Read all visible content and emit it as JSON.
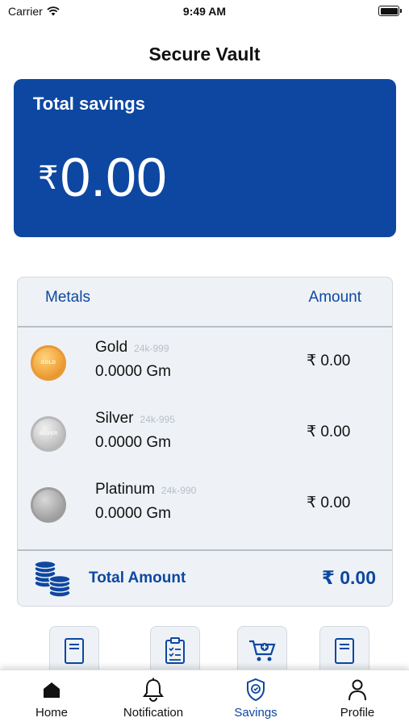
{
  "status_bar": {
    "carrier": "Carrier",
    "time": "9:49 AM"
  },
  "header": {
    "title": "Secure Vault"
  },
  "savings": {
    "label": "Total savings",
    "currency": "₹",
    "value": "0.00"
  },
  "metals": {
    "column_metals": "Metals",
    "column_amount": "Amount",
    "rows": [
      {
        "name": "Gold",
        "purity": "24k-999",
        "weight": "0.0000 Gm",
        "amount": "₹ 0.00",
        "coin_text": "GOLD"
      },
      {
        "name": "Silver",
        "purity": "24k-995",
        "weight": "0.0000 Gm",
        "amount": "₹ 0.00",
        "coin_text": "SILVER"
      },
      {
        "name": "Platinum",
        "purity": "24k-990",
        "weight": "0.0000 Gm",
        "amount": "₹ 0.00",
        "coin_text": ""
      }
    ],
    "total_label": "Total Amount",
    "total_value": "₹ 0.00"
  },
  "quick_actions": [
    "passbook-icon",
    "checklist-icon",
    "cart-icon",
    "book-icon"
  ],
  "tabs": [
    {
      "label": "Home",
      "icon": "home-icon",
      "active": false
    },
    {
      "label": "Notification",
      "icon": "bell-icon",
      "active": false
    },
    {
      "label": "Savings",
      "icon": "shield-icon",
      "active": true
    },
    {
      "label": "Profile",
      "icon": "person-icon",
      "active": false
    }
  ],
  "colors": {
    "primary": "#0d47a1",
    "card_bg": "#eef2f6"
  }
}
